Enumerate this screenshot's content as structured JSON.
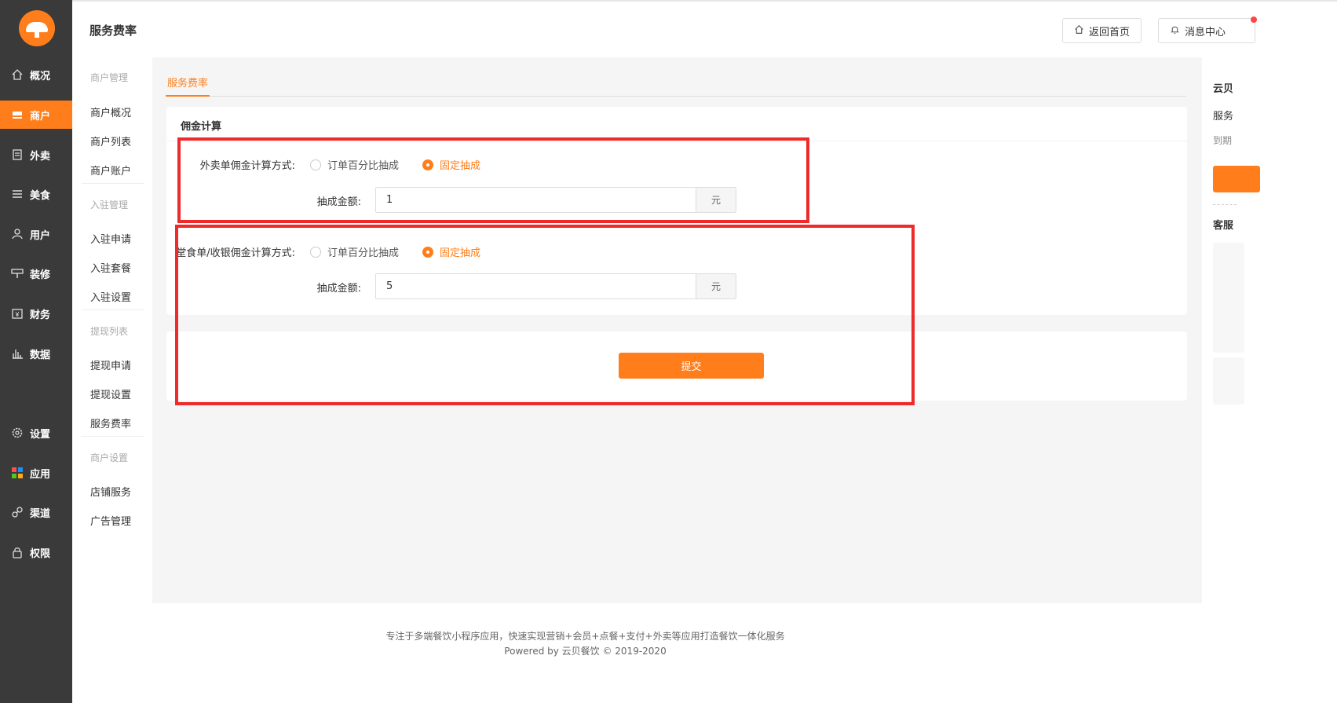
{
  "app": {
    "logo_icon": "mushroom-logo-icon"
  },
  "sidebar": {
    "items": [
      {
        "label": "概况",
        "icon": "home-icon",
        "active": false
      },
      {
        "label": "商户",
        "icon": "store-icon",
        "active": true
      },
      {
        "label": "外卖",
        "icon": "document-icon",
        "active": false
      },
      {
        "label": "美食",
        "icon": "menu-icon",
        "active": false
      },
      {
        "label": "用户",
        "icon": "user-icon",
        "active": false
      },
      {
        "label": "装修",
        "icon": "paint-roller-icon",
        "active": false
      },
      {
        "label": "财务",
        "icon": "wallet-icon",
        "active": false
      },
      {
        "label": "数据",
        "icon": "bar-chart-icon",
        "active": false
      },
      {
        "label": "设置",
        "icon": "gear-icon",
        "active": false
      },
      {
        "label": "应用",
        "icon": "apps-grid-icon",
        "active": false
      },
      {
        "label": "渠道",
        "icon": "link-icon",
        "active": false
      },
      {
        "label": "权限",
        "icon": "lock-icon",
        "active": false
      }
    ]
  },
  "header": {
    "title": "服务费率",
    "home_button": "返回首页",
    "message_button": "消息中心"
  },
  "submenu": {
    "groups": [
      {
        "title": "商户管理",
        "items": [
          "商户概况",
          "商户列表",
          "商户账户"
        ]
      },
      {
        "title": "入驻管理",
        "items": [
          "入驻申请",
          "入驻套餐",
          "入驻设置"
        ]
      },
      {
        "title": "提现列表",
        "items": [
          "提现申请",
          "提现设置",
          "服务费率"
        ]
      },
      {
        "title": "商户设置",
        "items": [
          "店铺服务",
          "广告管理"
        ]
      }
    ]
  },
  "main": {
    "tab": "服务费率",
    "card_title": "佣金计算",
    "takeout": {
      "label": "外卖单佣金计算方式:",
      "option_percent": "订单百分比抽成",
      "option_fixed": "固定抽成",
      "selected": "fixed",
      "amount_label": "抽成金额:",
      "amount_value": "1",
      "unit": "元"
    },
    "dinein": {
      "label": "堂食单/收银佣金计算方式:",
      "option_percent": "订单百分比抽成",
      "option_fixed": "固定抽成",
      "selected": "fixed",
      "amount_label": "抽成金额:",
      "amount_value": "5",
      "unit": "元"
    },
    "submit": "提交"
  },
  "right_panel": {
    "line1": "云贝",
    "line2": "服务",
    "line3": "到期",
    "line4": "客服"
  },
  "footer": {
    "text": "专注于多端餐饮小程序应用，快速实现营销+会员+点餐+支付+外卖等应用打造餐饮一体化服务",
    "copyright": "Powered by 云贝餐饮 © 2019-2020"
  },
  "colors": {
    "accent": "#ff7e1b",
    "sidebar_bg": "#3a3a3a",
    "annotation_red": "#ee2a2a"
  }
}
